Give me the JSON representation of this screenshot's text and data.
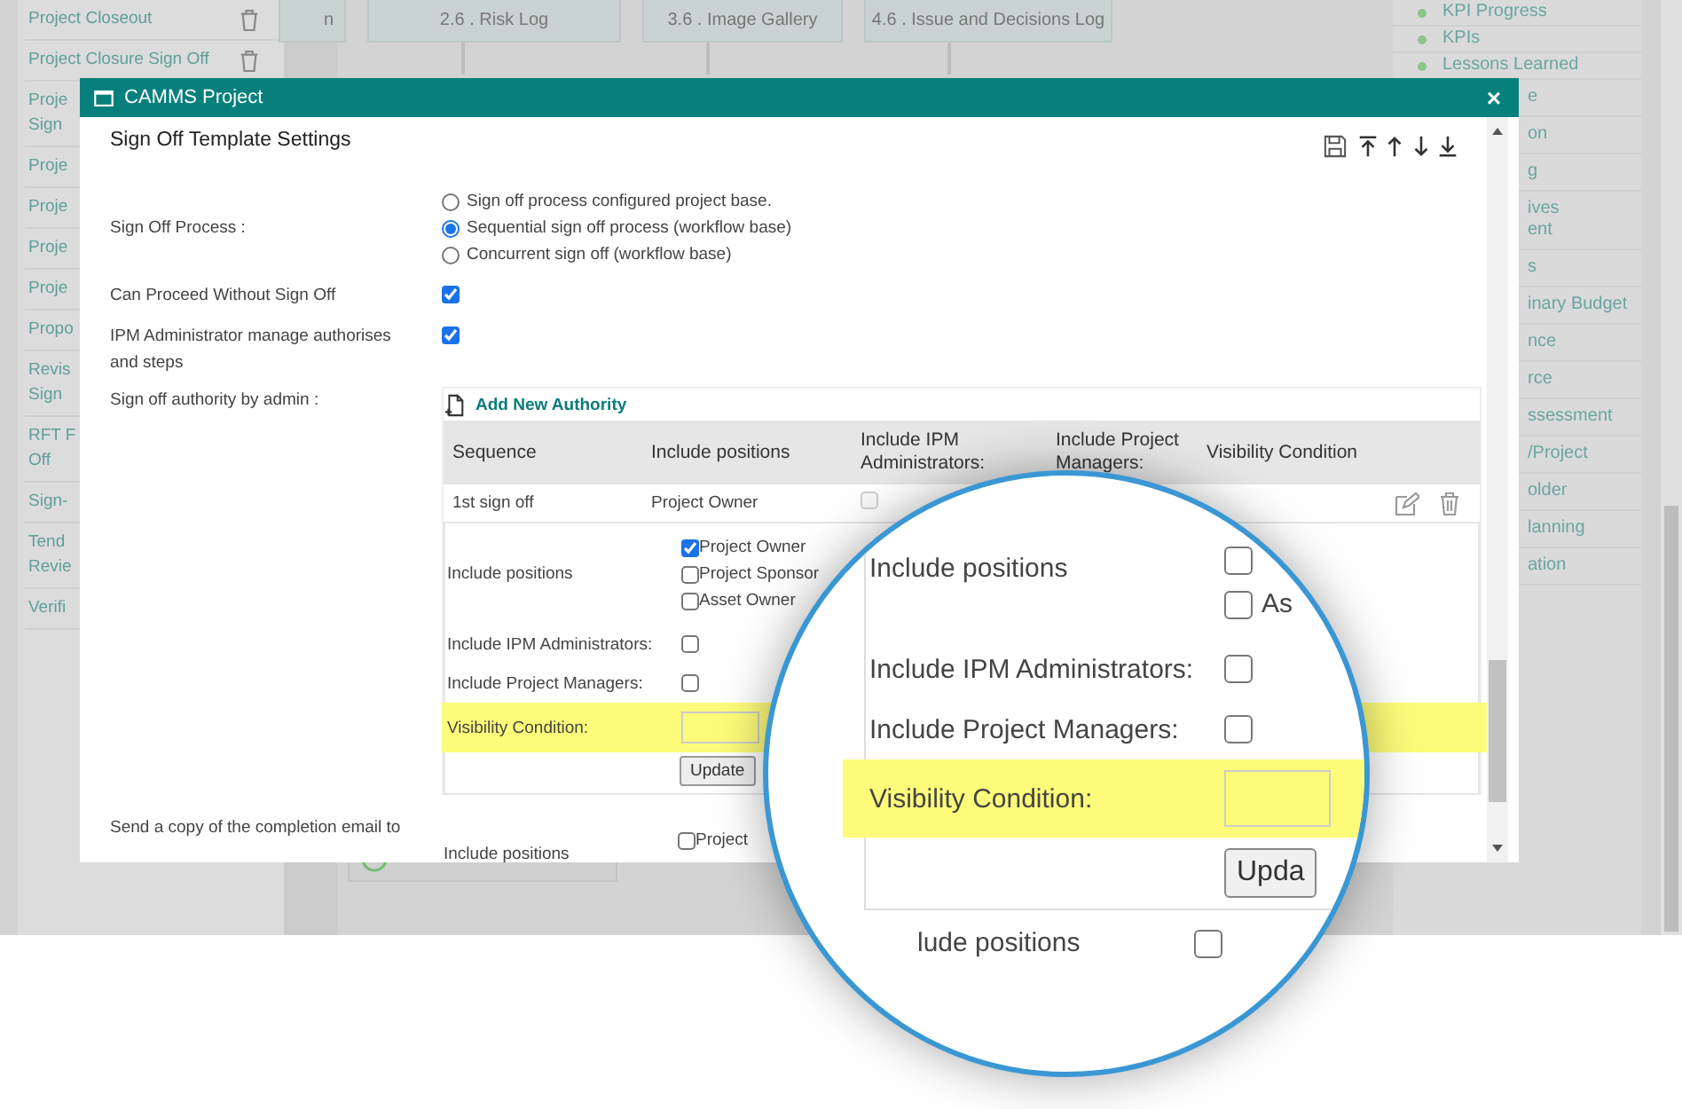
{
  "background": {
    "left_nav": [
      {
        "lines": [
          "Project Closeout"
        ],
        "deletable": true
      },
      {
        "lines": [
          "Project Closure Sign Off"
        ],
        "deletable": true
      },
      {
        "lines": [
          "Proje",
          "Sign"
        ]
      },
      {
        "lines": [
          "Proje"
        ]
      },
      {
        "lines": [
          "Proje"
        ]
      },
      {
        "lines": [
          "Proje"
        ]
      },
      {
        "lines": [
          "Proje"
        ]
      },
      {
        "lines": [
          "Propo"
        ]
      },
      {
        "lines": [
          "Revis",
          "Sign"
        ]
      },
      {
        "lines": [
          "RFT F",
          "Off"
        ]
      },
      {
        "lines": [
          "Sign-"
        ]
      },
      {
        "lines": [
          "Tend",
          "Revie"
        ]
      },
      {
        "lines": [
          "Verifi"
        ]
      }
    ],
    "tiles": [
      "n",
      "2.6 . Risk Log",
      "3.6 . Image Gallery",
      "4.6 . Issue and Decisions Log"
    ],
    "right_nav": [
      {
        "lines": [
          "KPI Progress"
        ],
        "dot": true
      },
      {
        "lines": [
          "KPIs"
        ],
        "dot": true
      },
      {
        "lines": [
          "Lessons Learned"
        ],
        "dot": true
      },
      {
        "lines": [
          "e"
        ],
        "dot": false
      },
      {
        "lines": [
          "on"
        ],
        "dot": false
      },
      {
        "lines": [
          "g"
        ],
        "dot": false
      },
      {
        "lines": [
          "ives",
          "ent"
        ],
        "dot": false
      },
      {
        "lines": [
          "s"
        ],
        "dot": false
      },
      {
        "lines": [
          "inary Budget"
        ],
        "dot": false
      },
      {
        "lines": [
          "nce"
        ],
        "dot": false
      },
      {
        "lines": [
          "rce"
        ],
        "dot": false
      },
      {
        "lines": [
          "ssessment"
        ],
        "dot": false
      },
      {
        "lines": [
          "/Project"
        ],
        "dot": false
      },
      {
        "lines": [
          "older"
        ],
        "dot": false
      },
      {
        "lines": [
          "lanning"
        ],
        "dot": false
      },
      {
        "lines": [
          "ation"
        ],
        "dot": false
      }
    ]
  },
  "dialog": {
    "title": "CAMMS Project",
    "close": "×",
    "heading": "Sign Off Template Settings",
    "sign_off_process": {
      "label": "Sign Off Process :",
      "options": [
        {
          "label": "Sign off process configured project base.",
          "selected": false
        },
        {
          "label": "Sequential sign off process (workflow base)",
          "selected": true
        },
        {
          "label": "Concurrent sign off (workflow base)",
          "selected": false
        }
      ]
    },
    "can_proceed": {
      "label": "Can Proceed Without Sign Off",
      "checked": true
    },
    "ipm_manage": {
      "label": "IPM Administrator manage authorises and steps",
      "checked": true
    },
    "authority": {
      "label": "Sign off authority by admin :",
      "add_link": "Add New Authority",
      "columns": [
        "Sequence",
        "Include positions",
        "Include IPM Administrators:",
        "Include Project Managers:",
        "Visibility Condition"
      ],
      "rows": [
        {
          "sequence": "1st sign off",
          "positions": "Project Owner",
          "ipm_checked": false,
          "ipm_disabled": true
        }
      ],
      "editor": {
        "positions_label": "Include positions",
        "positions": [
          {
            "label": "Project Owner",
            "checked": true
          },
          {
            "label": "Project Sponsor",
            "checked": false
          },
          {
            "label": "Asset Owner",
            "checked": false
          }
        ],
        "ipm_label": "Include IPM Administrators:",
        "ipm_checked": false,
        "pm_label": "Include Project Managers:",
        "pm_checked": false,
        "visibility_label": "Visibility Condition:",
        "highlighted": true,
        "update_button": "Update"
      }
    },
    "completion_email": {
      "label": "Send a copy of the completion email to",
      "positions_label": "Include positions",
      "positions": [
        {
          "label": "Project",
          "checked": false
        }
      ]
    }
  },
  "magnifier": {
    "positions_label": "Include positions",
    "positions": [
      {
        "checked": false
      },
      {
        "label": "As",
        "checked": false
      }
    ],
    "ipm_label": "Include IPM Administrators:",
    "ipm_checked": false,
    "pm_label": "Include Project Managers:",
    "pm_checked": false,
    "visibility_label": "Visibility Condition:",
    "highlighted": true,
    "update_button": "Upda",
    "next_label": "lude positions",
    "next_checked": false
  }
}
